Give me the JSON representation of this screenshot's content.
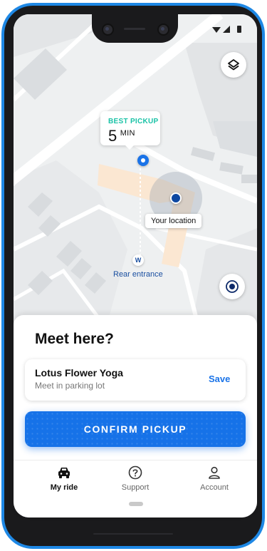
{
  "map": {
    "pickup": {
      "tag": "BEST PICKUP",
      "minutes": "5",
      "unit": "MIN"
    },
    "your_location_label": "Your location",
    "entrance_marker": "W",
    "entrance_label": "Rear entrance",
    "icons": {
      "layers": "layers-icon",
      "locate": "my-location-icon"
    }
  },
  "sheet": {
    "title": "Meet here?",
    "place": {
      "name": "Lotus Flower Yoga",
      "detail": "Meet in parking lot",
      "save_label": "Save"
    },
    "confirm_label": "CONFIRM PICKUP"
  },
  "nav": {
    "items": [
      {
        "label": "My ride",
        "icon": "car-icon",
        "active": true
      },
      {
        "label": "Support",
        "icon": "help-circle-icon",
        "active": false
      },
      {
        "label": "Account",
        "icon": "person-icon",
        "active": false
      }
    ]
  },
  "colors": {
    "accent": "#1672e8",
    "pickup_tag": "#19c2a6",
    "frame": "#1e88e5"
  }
}
